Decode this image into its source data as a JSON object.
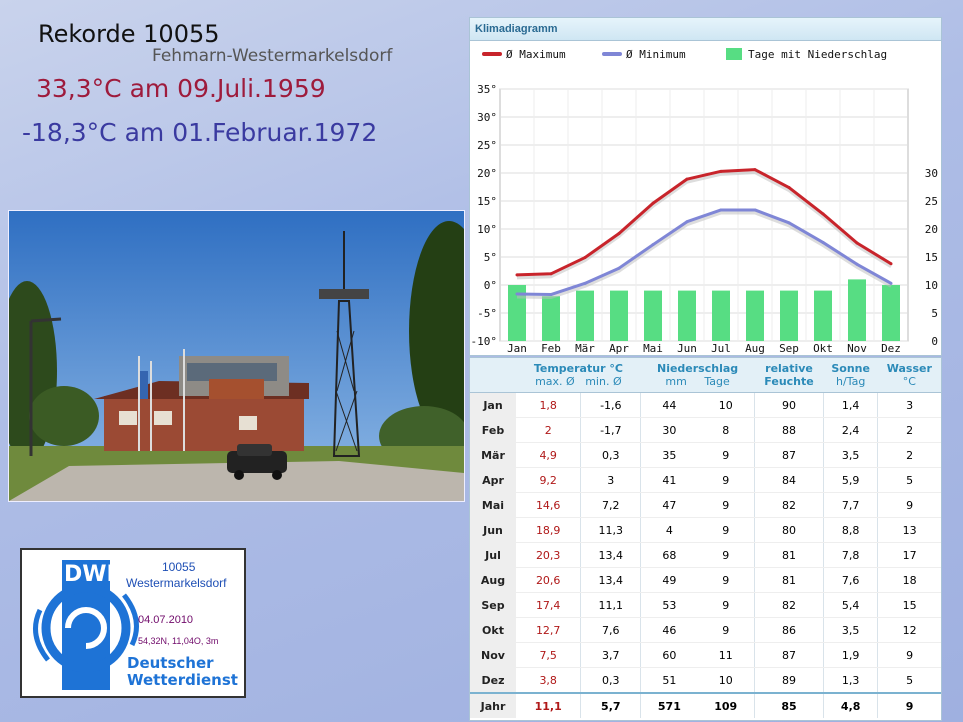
{
  "header": {
    "title": "Rekorde 10055",
    "station": "Fehmarn-Westermarkelsdorf",
    "record_max": "33,3°C am 09.Juli.1959",
    "record_min": "-18,3°C am 01.Februar.1972"
  },
  "logo": {
    "brand": "DWD",
    "station_id": "10055",
    "station_name": "Westermarkelsdorf",
    "date": "04.07.2010",
    "coords": "54,32N, 11,04O, 3m",
    "org_line1": "Deutscher",
    "org_line2": "Wetterdienst"
  },
  "chart_title": "Klimadiagramm",
  "chart_data": {
    "type": "line",
    "categories": [
      "Jan",
      "Feb",
      "Mär",
      "Apr",
      "Mai",
      "Jun",
      "Jul",
      "Aug",
      "Sep",
      "Okt",
      "Nov",
      "Dez"
    ],
    "series": [
      {
        "name": "Ø Maximum",
        "color": "#c8242b",
        "values": [
          1.8,
          2,
          4.9,
          9.2,
          14.6,
          18.9,
          20.3,
          20.6,
          17.4,
          12.7,
          7.5,
          3.8
        ]
      },
      {
        "name": "Ø Minimum",
        "color": "#7f86d6",
        "values": [
          -1.6,
          -1.7,
          0.3,
          3,
          7.2,
          11.3,
          13.4,
          13.4,
          11.1,
          7.6,
          3.7,
          0.3
        ]
      },
      {
        "name": "Tage mit Niederschlag",
        "type": "bar",
        "color": "#57dd83",
        "values": [
          10,
          8,
          9,
          9,
          9,
          9,
          9,
          9,
          9,
          9,
          11,
          10
        ]
      }
    ],
    "y_left": {
      "ticks": [
        "35°",
        "30°",
        "25°",
        "20°",
        "15°",
        "10°",
        "5°",
        "0°",
        "-5°",
        "-10°"
      ],
      "ylim": [
        -10,
        35
      ]
    },
    "y_right": {
      "ticks": [
        "30",
        "25",
        "20",
        "15",
        "10",
        "5",
        "0"
      ],
      "ylim": [
        0,
        30
      ]
    },
    "grid": true,
    "legend": "top"
  },
  "table": {
    "headers": {
      "temp": "Temperatur °C",
      "temp_max": "max. Ø",
      "temp_min": "min. Ø",
      "precip": "Niederschlag",
      "precip_mm": "mm",
      "precip_days": "Tage",
      "humid1": "relative",
      "humid2": "Feuchte",
      "sun": "Sonne",
      "sun_unit": "h/Tag",
      "water": "Wasser",
      "water_unit": "°C"
    },
    "rows": [
      [
        "Jan",
        "1,8",
        "-1,6",
        "44",
        "10",
        "90",
        "1,4",
        "3"
      ],
      [
        "Feb",
        "2",
        "-1,7",
        "30",
        "8",
        "88",
        "2,4",
        "2"
      ],
      [
        "Mär",
        "4,9",
        "0,3",
        "35",
        "9",
        "87",
        "3,5",
        "2"
      ],
      [
        "Apr",
        "9,2",
        "3",
        "41",
        "9",
        "84",
        "5,9",
        "5"
      ],
      [
        "Mai",
        "14,6",
        "7,2",
        "47",
        "9",
        "82",
        "7,7",
        "9"
      ],
      [
        "Jun",
        "18,9",
        "11,3",
        "4",
        "9",
        "80",
        "8,8",
        "13"
      ],
      [
        "Jul",
        "20,3",
        "13,4",
        "68",
        "9",
        "81",
        "7,8",
        "17"
      ],
      [
        "Aug",
        "20,6",
        "13,4",
        "49",
        "9",
        "81",
        "7,6",
        "18"
      ],
      [
        "Sep",
        "17,4",
        "11,1",
        "53",
        "9",
        "82",
        "5,4",
        "15"
      ],
      [
        "Okt",
        "12,7",
        "7,6",
        "46",
        "9",
        "86",
        "3,5",
        "12"
      ],
      [
        "Nov",
        "7,5",
        "3,7",
        "60",
        "11",
        "87",
        "1,9",
        "9"
      ],
      [
        "Dez",
        "3,8",
        "0,3",
        "51",
        "10",
        "89",
        "1,3",
        "5"
      ]
    ],
    "total": [
      "Jahr",
      "11,1",
      "5,7",
      "571",
      "109",
      "85",
      "4,8",
      "9"
    ]
  }
}
